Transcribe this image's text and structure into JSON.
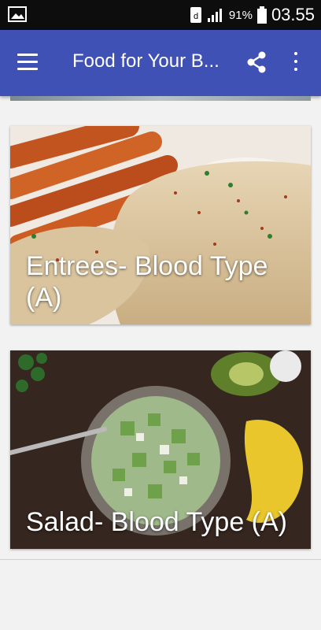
{
  "status": {
    "battery_percent": "91%",
    "time": "03.55"
  },
  "toolbar": {
    "title": "Food for Your B..."
  },
  "cards": [
    {
      "title": "Entrees- Blood Type (A)"
    },
    {
      "title": "Salad- Blood Type (A)"
    }
  ],
  "colors": {
    "app_bar": "#3f51b5",
    "status_bar": "#0d0d0d",
    "background": "#f2f2f2"
  }
}
